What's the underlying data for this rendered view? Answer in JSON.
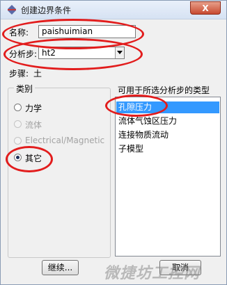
{
  "window": {
    "title": "创建边界条件",
    "close_label": "X"
  },
  "form": {
    "name_label": "名称:",
    "name_value": "paishuimian",
    "step_label": "分析步:",
    "step_value": "ht2",
    "procedure_label": "步骤:",
    "procedure_value": "土"
  },
  "category": {
    "title": "类别",
    "options": [
      {
        "label": "力学",
        "selected": false,
        "enabled": true
      },
      {
        "label": "流体",
        "selected": false,
        "enabled": false
      },
      {
        "label": "Electrical/Magnetic",
        "selected": false,
        "enabled": false
      },
      {
        "label": "其它",
        "selected": true,
        "enabled": true
      }
    ]
  },
  "types": {
    "title": "可用于所选分析步的类型",
    "items": [
      "孔隙压力",
      "流体气蚀区压力",
      "连接物质流动",
      "子模型"
    ],
    "selected_index": 0
  },
  "buttons": {
    "continue_label": "继续...",
    "cancel_label": "取消"
  },
  "watermark": {
    "text": "微捷坊工控网"
  },
  "colors": {
    "annotation": "#e21c1c",
    "selection": "#3399ff"
  }
}
